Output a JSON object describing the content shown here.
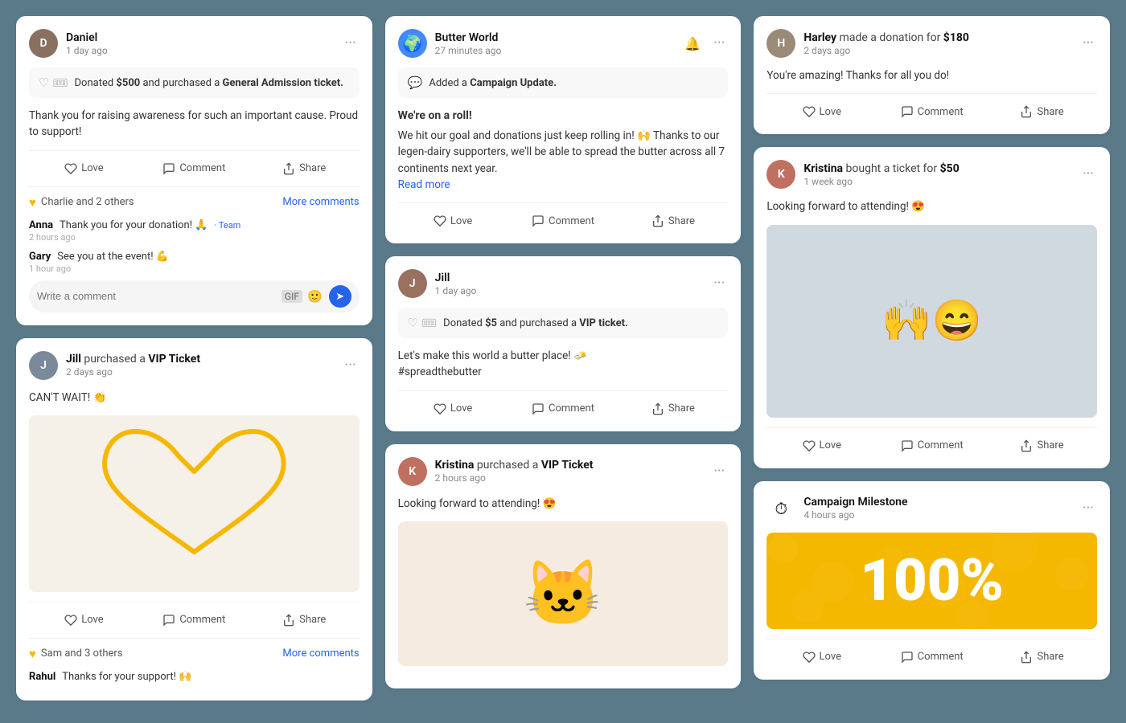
{
  "page": {
    "background": "#5a7a8a"
  },
  "cards": {
    "col1": {
      "card1": {
        "user": "Daniel",
        "action": "",
        "time": "1 day ago",
        "activity": "Donated $500 and purchased a General Admission ticket.",
        "body": "Thank you for raising awareness for such an important cause. Proud to support!",
        "love": "Love",
        "comment": "Comment",
        "share": "Share",
        "commentSummary": "Charlie and 2 others",
        "moreComments": "More comments",
        "comments": [
          {
            "name": "Anna",
            "text": "Thank you for your donation! 🙏",
            "time": "2 hours ago",
            "badge": "Team"
          },
          {
            "name": "Gary",
            "text": "See you at the event! 💪",
            "time": "1 hour ago"
          }
        ],
        "commentPlaceholder": "Write a comment"
      },
      "card2": {
        "user": "Jill",
        "action": "purchased a",
        "actionBold": "VIP Ticket",
        "time": "2 days ago",
        "body": "CAN'T WAIT! 👏",
        "love": "Love",
        "comment": "Comment",
        "share": "Share",
        "commentSummary": "Sam and 3 others",
        "moreComments": "More comments",
        "bottomComment": {
          "name": "Rahul",
          "text": "Thanks for your support! 🙌"
        }
      }
    },
    "col2": {
      "card1": {
        "user": "Butter World",
        "time": "27 minutes ago",
        "activity": "Added a Campaign Update.",
        "headline": "We're on a roll!",
        "body": "We hit our goal and donations just keep rolling in! 🙌 Thanks to our legen-dairy supporters, we'll be able to spread the butter across all 7 continents next year.",
        "readMore": "Read more",
        "love": "Love",
        "comment": "Comment",
        "share": "Share"
      },
      "card2": {
        "user": "Jill",
        "time": "1 day ago",
        "activity": "Donated $5 and purchased a VIP ticket.",
        "body": "Let's make this world a butter place! 🧈\n#spreadthebutter",
        "love": "Love",
        "comment": "Comment",
        "share": "Share"
      },
      "card3": {
        "user": "Kristina",
        "action": "purchased a",
        "actionBold": "VIP Ticket",
        "time": "2 hours ago",
        "body": "Looking forward to attending! 😍",
        "love": "Love",
        "comment": "Comment",
        "share": "Share"
      }
    },
    "col3": {
      "card1": {
        "user": "Harley",
        "action": "made a donation for",
        "actionBold": "$180",
        "time": "2 days ago",
        "body": "You're amazing! Thanks for all you do!",
        "love": "Love",
        "comment": "Comment",
        "share": "Share"
      },
      "card2": {
        "user": "Kristina",
        "action": "bought a ticket for",
        "actionBold": "$50",
        "time": "1 week ago",
        "body": "Looking forward to attending! 😍",
        "love": "Love",
        "comment": "Comment",
        "share": "Share"
      },
      "card3": {
        "user": "Campaign Milestone",
        "time": "4 hours ago",
        "milestoneValue": "100%",
        "love": "Love",
        "comment": "Comment",
        "share": "Share"
      }
    }
  }
}
